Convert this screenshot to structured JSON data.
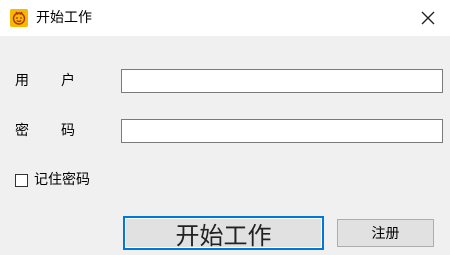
{
  "window": {
    "title": "开始工作",
    "app_icon": "smiley-app-icon",
    "close_icon": "close-icon",
    "app_icon_color": "#f6b800"
  },
  "form": {
    "user_label_chars": [
      "用",
      "户"
    ],
    "password_label_chars": [
      "密",
      "码"
    ],
    "user_value": "",
    "password_value": "",
    "remember_label": "记住密码",
    "remember_checked": false
  },
  "buttons": {
    "start_label": "开始工作",
    "register_label": "注册",
    "focus_color": "#0078d7"
  }
}
